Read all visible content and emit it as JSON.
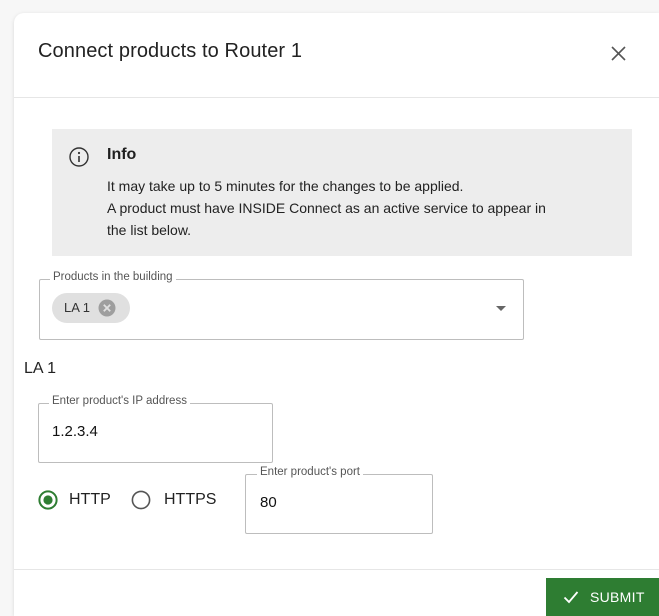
{
  "dialog": {
    "title": "Connect products to Router 1",
    "close_icon": "close-icon"
  },
  "info": {
    "icon": "info-icon",
    "title": "Info",
    "lines": [
      "It may take up to 5 minutes for the changes to be applied.",
      "A product must have INSIDE Connect as an active service to appear in",
      "the list below."
    ]
  },
  "products_field": {
    "legend": "Products in the building",
    "chips": [
      {
        "label": "LA 1",
        "remove_icon": "remove-chip-icon"
      }
    ],
    "dropdown_icon": "dropdown-arrow-icon"
  },
  "product": {
    "heading": "LA 1",
    "ip_field": {
      "legend": "Enter product's IP address",
      "value": "1.2.3.4"
    },
    "protocol": {
      "options": [
        {
          "label": "HTTP",
          "selected": true
        },
        {
          "label": "HTTPS",
          "selected": false
        }
      ]
    },
    "port_field": {
      "legend": "Enter product's port",
      "value": "80"
    }
  },
  "footer": {
    "submit_label": "SUBMIT",
    "submit_icon": "check-icon"
  },
  "colors": {
    "accent": "#2e7d32",
    "info_background": "#ededed",
    "chip_background": "#e0e0e0"
  }
}
